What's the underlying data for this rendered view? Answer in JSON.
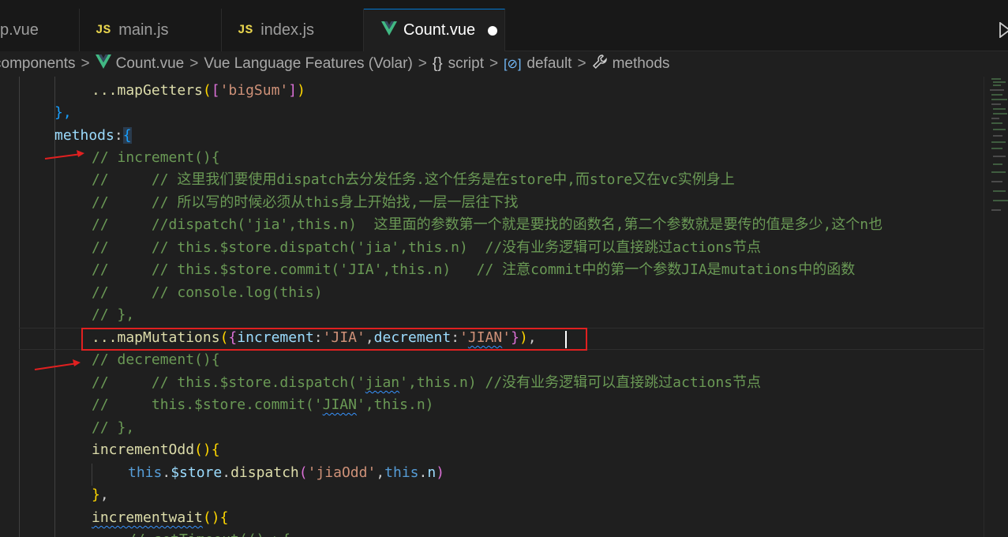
{
  "tabs": [
    {
      "label": "p.vue",
      "icon": "vue-icon"
    },
    {
      "label": "main.js",
      "icon": "js-icon",
      "badge": "JS"
    },
    {
      "label": "index.js",
      "icon": "js-icon",
      "badge": "JS"
    },
    {
      "label": "Count.vue",
      "icon": "vue-icon",
      "active": true,
      "modified": true
    }
  ],
  "breadcrumb": {
    "components": "components",
    "file": "Count.vue",
    "language": "Vue Language Features (Volar)",
    "braces": "{}",
    "script": "script",
    "cube": "[⊘]",
    "default": "default",
    "methods": "methods",
    "sep": ">"
  },
  "code": {
    "l1_a": "...mapGetters",
    "l1_b": "(",
    "l1_c": "[",
    "l1_d": "'bigSum'",
    "l1_e": "]",
    "l1_f": ")",
    "l2": "},",
    "l3_a": "methods",
    "l3_b": ":",
    "l3_c": "{",
    "l4": "// increment(){",
    "l5": "//     // 这里我们要使用dispatch去分发任务.这个任务是在store中,而store又在vc实例身上",
    "l6": "//     // 所以写的时候必须从this身上开始找,一层一层往下找",
    "l7": "//     //dispatch('jia',this.n)  这里面的参数第一个就是要找的函数名,第二个参数就是要传的值是多少,这个n也",
    "l8": "//     // this.$store.dispatch('jia',this.n)  //没有业务逻辑可以直接跳过actions节点",
    "l9": "//     // this.$store.commit('JIA',this.n)   // 注意commit中的第一个参数JIA是mutations中的函数",
    "l10": "//     // console.log(this)",
    "l11": "// },",
    "l12_a": "...mapMutations",
    "l12_b": "(",
    "l12_c": "{",
    "l12_d": "increment",
    "l12_e": ":",
    "l12_f": "'JIA'",
    "l12_g": ",",
    "l12_h": "decrement",
    "l12_i": ":",
    "l12_j1": "'",
    "l12_j2": "JIAN",
    "l12_j3": "'",
    "l12_k": "}",
    "l12_l": ")",
    "l12_m": ",",
    "l13": "// decrement(){",
    "l14_a": "//     // this.$store.dispatch('",
    "l14_b": "jian",
    "l14_c": "',this.n) //没有业务逻辑可以直接跳过actions节点",
    "l15_a": "//     this.$store.commit('",
    "l15_b": "JIAN",
    "l15_c": "',this.n)",
    "l16": "// },",
    "l17_a": "incrementOdd",
    "l17_b": "()",
    "l17_c": "{",
    "l18_a": "this",
    "l18_b": ".",
    "l18_c": "$store",
    "l18_d": ".",
    "l18_e": "dispatch",
    "l18_f": "(",
    "l18_g": "'jiaOdd'",
    "l18_h": ",",
    "l18_i": "this",
    "l18_j": ".",
    "l18_k": "n",
    "l18_l": ")",
    "l19_a": "}",
    "l19_b": ",",
    "l20_a": "incrementwait",
    "l20_b": "()",
    "l20_c": "{",
    "l21": "// setTimeout(()=>{"
  },
  "colors": {
    "comment": "#6a9955",
    "keyword": "#569cd6",
    "variable": "#9cdcfe",
    "function": "#dcdcaa",
    "string": "#ce9178",
    "annotation_red": "#e02020"
  }
}
